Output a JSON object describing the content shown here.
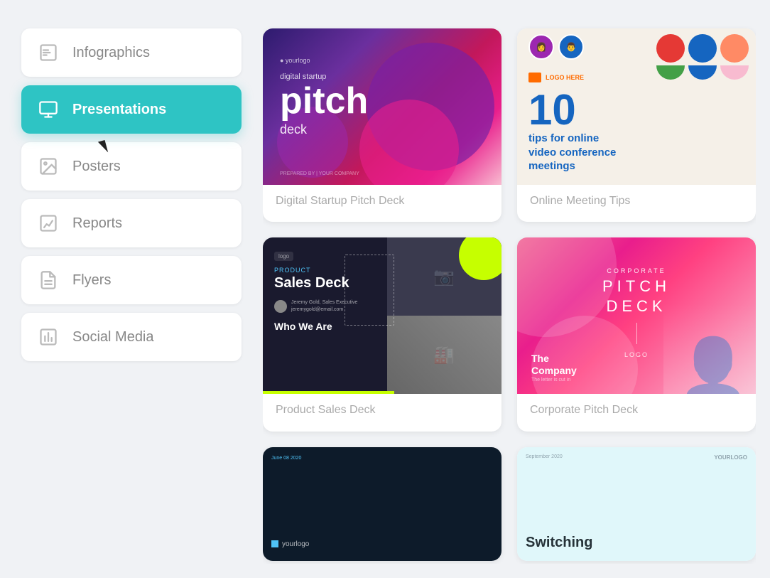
{
  "sidebar": {
    "items": [
      {
        "id": "infographics",
        "label": "Infographics",
        "icon": "bar-chart-icon",
        "active": false
      },
      {
        "id": "presentations",
        "label": "Presentations",
        "icon": "presentation-icon",
        "active": true
      },
      {
        "id": "posters",
        "label": "Posters",
        "icon": "image-icon",
        "active": false
      },
      {
        "id": "reports",
        "label": "Reports",
        "icon": "line-chart-icon",
        "active": false
      },
      {
        "id": "flyers",
        "label": "Flyers",
        "icon": "file-text-icon",
        "active": false
      },
      {
        "id": "social-media",
        "label": "Social Media",
        "icon": "bar-chart-2-icon",
        "active": false
      }
    ]
  },
  "templates": {
    "cards": [
      {
        "id": "digital-startup",
        "title": "Digital Startup Pitch Deck",
        "thumb_type": "thumb-1"
      },
      {
        "id": "online-meeting",
        "title": "Online Meeting Tips",
        "thumb_type": "thumb-2"
      },
      {
        "id": "product-sales",
        "title": "Product Sales Deck",
        "thumb_type": "thumb-3"
      },
      {
        "id": "corporate-pitch",
        "title": "Corporate Pitch Deck",
        "thumb_type": "thumb-4"
      }
    ],
    "partial_cards": [
      {
        "id": "partial-left",
        "thumb_type": "thumb-5"
      },
      {
        "id": "partial-right",
        "thumb_type": "thumb-6",
        "switching_text": "Switching"
      }
    ]
  },
  "thumb1": {
    "logo": "● yourlogo",
    "small_text": "digital startup",
    "big_text": "pitch",
    "sub_text": "deck",
    "prepared": "PREPARED BY | YOUR COMPANY"
  },
  "thumb2": {
    "logo_text": "LOGO HERE",
    "number": "10",
    "tips_line1": "tips for online",
    "tips_line2": "video conference",
    "tips_line3": "meetings"
  },
  "thumb3": {
    "logo": "logo",
    "category": "PRODUCT",
    "title": "Sales Deck",
    "person_name": "Jeremy Gold, Sales Executive",
    "person_email": "jeremygold@email.com",
    "who_we_are": "Who We Are"
  },
  "thumb4": {
    "corp": "CORPORATE",
    "pitch": "PITCH",
    "deck": "DECK",
    "logo": "LOGO",
    "company": "The\nCompany"
  },
  "thumb5": {
    "date": "June 08 2020",
    "logo_text": "yourlogo"
  },
  "thumb6": {
    "date": "September 2020",
    "yourlogo": "YOURLOGO",
    "title": "Switching"
  }
}
